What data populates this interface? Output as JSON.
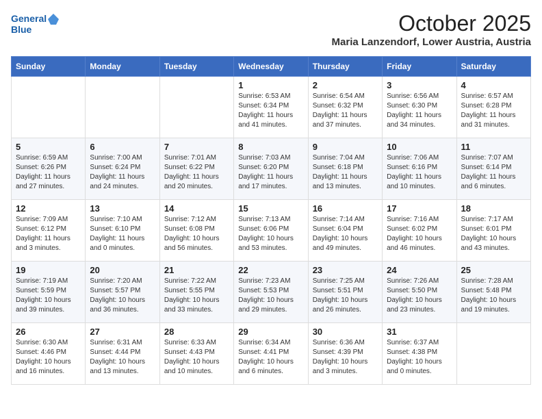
{
  "logo": {
    "line1": "General",
    "line2": "Blue"
  },
  "title": "October 2025",
  "location": "Maria Lanzendorf, Lower Austria, Austria",
  "days_of_week": [
    "Sunday",
    "Monday",
    "Tuesday",
    "Wednesday",
    "Thursday",
    "Friday",
    "Saturday"
  ],
  "weeks": [
    [
      {
        "day": "",
        "info": ""
      },
      {
        "day": "",
        "info": ""
      },
      {
        "day": "",
        "info": ""
      },
      {
        "day": "1",
        "info": "Sunrise: 6:53 AM\nSunset: 6:34 PM\nDaylight: 11 hours\nand 41 minutes."
      },
      {
        "day": "2",
        "info": "Sunrise: 6:54 AM\nSunset: 6:32 PM\nDaylight: 11 hours\nand 37 minutes."
      },
      {
        "day": "3",
        "info": "Sunrise: 6:56 AM\nSunset: 6:30 PM\nDaylight: 11 hours\nand 34 minutes."
      },
      {
        "day": "4",
        "info": "Sunrise: 6:57 AM\nSunset: 6:28 PM\nDaylight: 11 hours\nand 31 minutes."
      }
    ],
    [
      {
        "day": "5",
        "info": "Sunrise: 6:59 AM\nSunset: 6:26 PM\nDaylight: 11 hours\nand 27 minutes."
      },
      {
        "day": "6",
        "info": "Sunrise: 7:00 AM\nSunset: 6:24 PM\nDaylight: 11 hours\nand 24 minutes."
      },
      {
        "day": "7",
        "info": "Sunrise: 7:01 AM\nSunset: 6:22 PM\nDaylight: 11 hours\nand 20 minutes."
      },
      {
        "day": "8",
        "info": "Sunrise: 7:03 AM\nSunset: 6:20 PM\nDaylight: 11 hours\nand 17 minutes."
      },
      {
        "day": "9",
        "info": "Sunrise: 7:04 AM\nSunset: 6:18 PM\nDaylight: 11 hours\nand 13 minutes."
      },
      {
        "day": "10",
        "info": "Sunrise: 7:06 AM\nSunset: 6:16 PM\nDaylight: 11 hours\nand 10 minutes."
      },
      {
        "day": "11",
        "info": "Sunrise: 7:07 AM\nSunset: 6:14 PM\nDaylight: 11 hours\nand 6 minutes."
      }
    ],
    [
      {
        "day": "12",
        "info": "Sunrise: 7:09 AM\nSunset: 6:12 PM\nDaylight: 11 hours\nand 3 minutes."
      },
      {
        "day": "13",
        "info": "Sunrise: 7:10 AM\nSunset: 6:10 PM\nDaylight: 11 hours\nand 0 minutes."
      },
      {
        "day": "14",
        "info": "Sunrise: 7:12 AM\nSunset: 6:08 PM\nDaylight: 10 hours\nand 56 minutes."
      },
      {
        "day": "15",
        "info": "Sunrise: 7:13 AM\nSunset: 6:06 PM\nDaylight: 10 hours\nand 53 minutes."
      },
      {
        "day": "16",
        "info": "Sunrise: 7:14 AM\nSunset: 6:04 PM\nDaylight: 10 hours\nand 49 minutes."
      },
      {
        "day": "17",
        "info": "Sunrise: 7:16 AM\nSunset: 6:02 PM\nDaylight: 10 hours\nand 46 minutes."
      },
      {
        "day": "18",
        "info": "Sunrise: 7:17 AM\nSunset: 6:01 PM\nDaylight: 10 hours\nand 43 minutes."
      }
    ],
    [
      {
        "day": "19",
        "info": "Sunrise: 7:19 AM\nSunset: 5:59 PM\nDaylight: 10 hours\nand 39 minutes."
      },
      {
        "day": "20",
        "info": "Sunrise: 7:20 AM\nSunset: 5:57 PM\nDaylight: 10 hours\nand 36 minutes."
      },
      {
        "day": "21",
        "info": "Sunrise: 7:22 AM\nSunset: 5:55 PM\nDaylight: 10 hours\nand 33 minutes."
      },
      {
        "day": "22",
        "info": "Sunrise: 7:23 AM\nSunset: 5:53 PM\nDaylight: 10 hours\nand 29 minutes."
      },
      {
        "day": "23",
        "info": "Sunrise: 7:25 AM\nSunset: 5:51 PM\nDaylight: 10 hours\nand 26 minutes."
      },
      {
        "day": "24",
        "info": "Sunrise: 7:26 AM\nSunset: 5:50 PM\nDaylight: 10 hours\nand 23 minutes."
      },
      {
        "day": "25",
        "info": "Sunrise: 7:28 AM\nSunset: 5:48 PM\nDaylight: 10 hours\nand 19 minutes."
      }
    ],
    [
      {
        "day": "26",
        "info": "Sunrise: 6:30 AM\nSunset: 4:46 PM\nDaylight: 10 hours\nand 16 minutes."
      },
      {
        "day": "27",
        "info": "Sunrise: 6:31 AM\nSunset: 4:44 PM\nDaylight: 10 hours\nand 13 minutes."
      },
      {
        "day": "28",
        "info": "Sunrise: 6:33 AM\nSunset: 4:43 PM\nDaylight: 10 hours\nand 10 minutes."
      },
      {
        "day": "29",
        "info": "Sunrise: 6:34 AM\nSunset: 4:41 PM\nDaylight: 10 hours\nand 6 minutes."
      },
      {
        "day": "30",
        "info": "Sunrise: 6:36 AM\nSunset: 4:39 PM\nDaylight: 10 hours\nand 3 minutes."
      },
      {
        "day": "31",
        "info": "Sunrise: 6:37 AM\nSunset: 4:38 PM\nDaylight: 10 hours\nand 0 minutes."
      },
      {
        "day": "",
        "info": ""
      }
    ]
  ]
}
